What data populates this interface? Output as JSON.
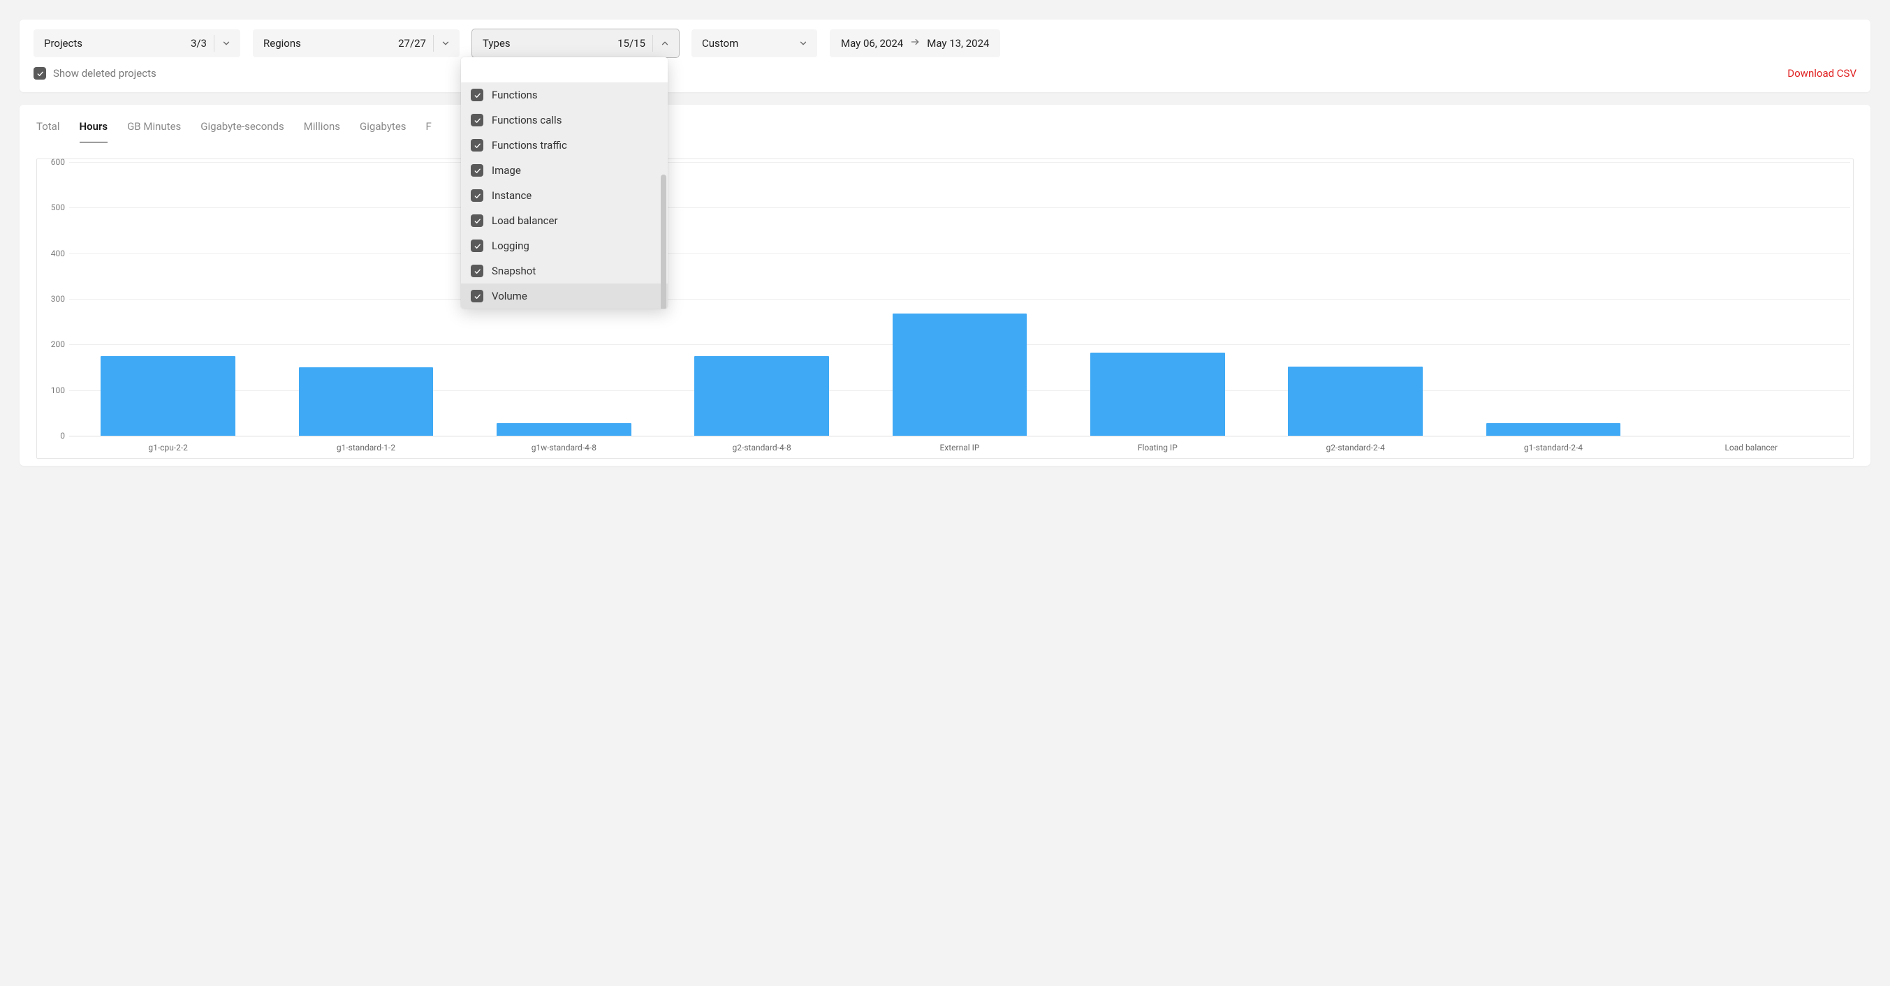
{
  "filters": {
    "projects": {
      "label": "Projects",
      "count": "3/3"
    },
    "regions": {
      "label": "Regions",
      "count": "27/27"
    },
    "types": {
      "label": "Types",
      "count": "15/15",
      "open": true
    },
    "range": {
      "label": "Custom"
    },
    "date_from": "May 06, 2024",
    "date_to": "May 13, 2024"
  },
  "show_deleted": {
    "label": "Show deleted projects",
    "checked": true
  },
  "download_label": "Download CSV",
  "types_options": [
    {
      "label": "Functions",
      "checked": true
    },
    {
      "label": "Functions calls",
      "checked": true
    },
    {
      "label": "Functions traffic",
      "checked": true
    },
    {
      "label": "Image",
      "checked": true
    },
    {
      "label": "Instance",
      "checked": true
    },
    {
      "label": "Load balancer",
      "checked": true
    },
    {
      "label": "Logging",
      "checked": true
    },
    {
      "label": "Snapshot",
      "checked": true
    },
    {
      "label": "Volume",
      "checked": true,
      "hover": true
    }
  ],
  "tabs": [
    "Total",
    "Hours",
    "GB Minutes",
    "Gigabyte-seconds",
    "Millions",
    "Gigabytes",
    "F"
  ],
  "active_tab": "Hours",
  "chart_data": {
    "type": "bar",
    "title": "",
    "xlabel": "",
    "ylabel": "",
    "ylim": [
      0,
      600
    ],
    "yticks": [
      0,
      100,
      200,
      300,
      400,
      500,
      600
    ],
    "categories": [
      "g1-cpu-2-2",
      "g1-standard-1-2",
      "g1w-standard-4-8",
      "g2-standard-4-8",
      "External IP",
      "Floating IP",
      "g2-standard-2-4",
      "g1-standard-2-4",
      "Load balancer"
    ],
    "values": [
      175,
      150,
      28,
      175,
      268,
      182,
      152,
      28,
      0
    ]
  },
  "colors": {
    "bar": "#3fa9f5",
    "accent_red": "#e02020"
  }
}
